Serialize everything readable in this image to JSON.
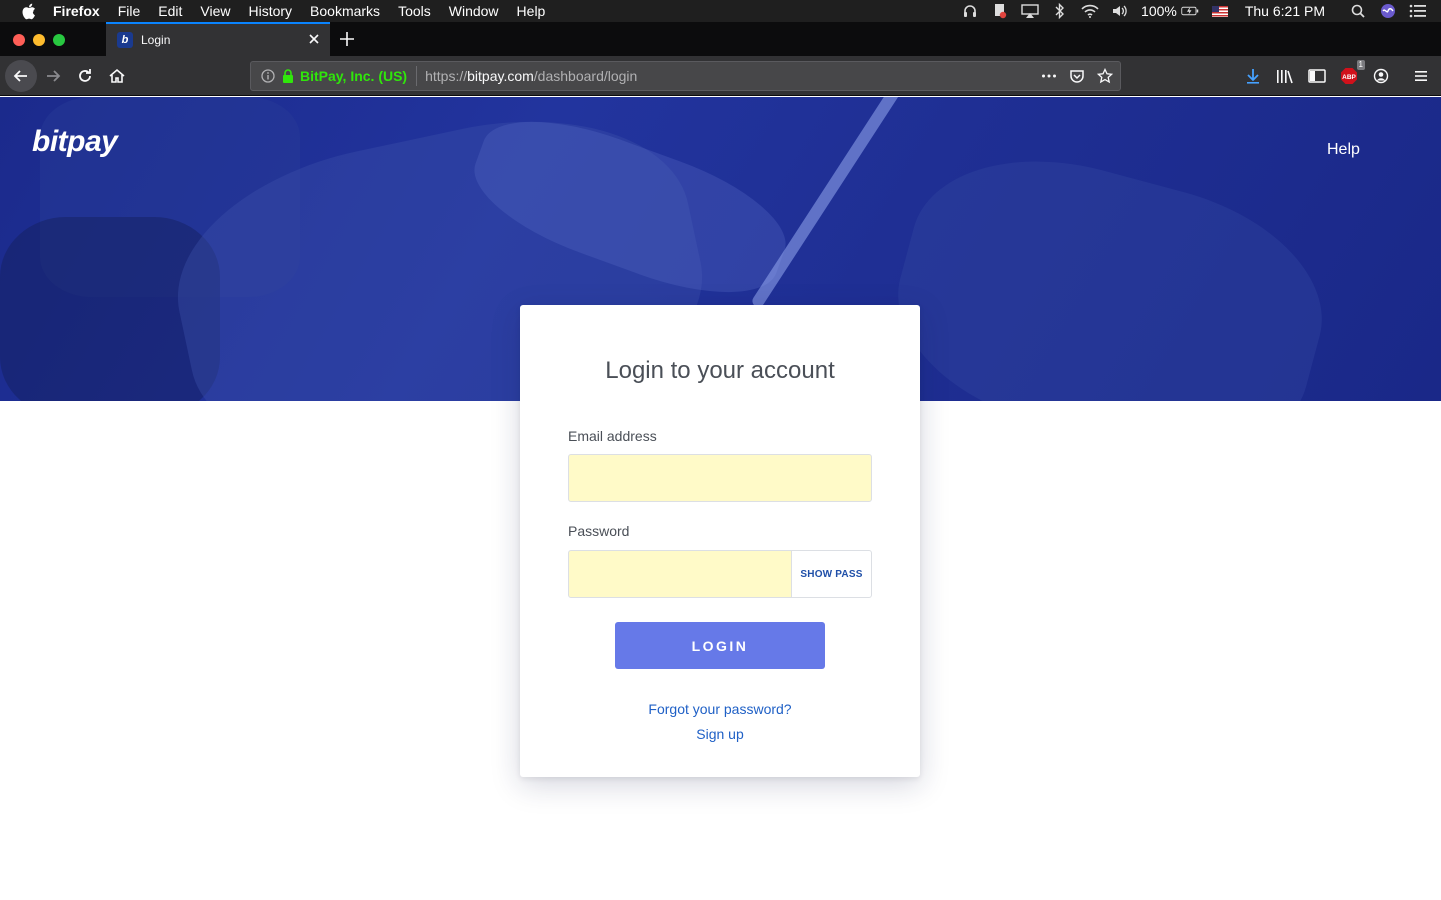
{
  "menubar": {
    "app_name": "Firefox",
    "items": [
      "File",
      "Edit",
      "View",
      "History",
      "Bookmarks",
      "Tools",
      "Window",
      "Help"
    ],
    "battery": "100%",
    "clock": "Thu 6:21 PM"
  },
  "tab": {
    "favicon_letter": "b",
    "title": "Login"
  },
  "urlbar": {
    "org": "BitPay, Inc. (US)",
    "url_prefix": "https://",
    "url_host": "bitpay.com",
    "url_path": "/dashboard/login"
  },
  "toolbar": {
    "abp_badge": "1"
  },
  "site": {
    "logo": "bitpay",
    "help": "Help"
  },
  "login": {
    "title": "Login to your account",
    "email_label": "Email address",
    "email_value": "",
    "password_label": "Password",
    "password_value": "",
    "show_pass": "SHOW PASS",
    "login_button": "LOGIN",
    "forgot": "Forgot your password?",
    "signup": "Sign up"
  },
  "colors": {
    "hero": "#1f2f94",
    "login_button": "#6679e8",
    "link": "#1f60c6",
    "autofill": "#fffac8",
    "secure_green": "#30e60b"
  }
}
